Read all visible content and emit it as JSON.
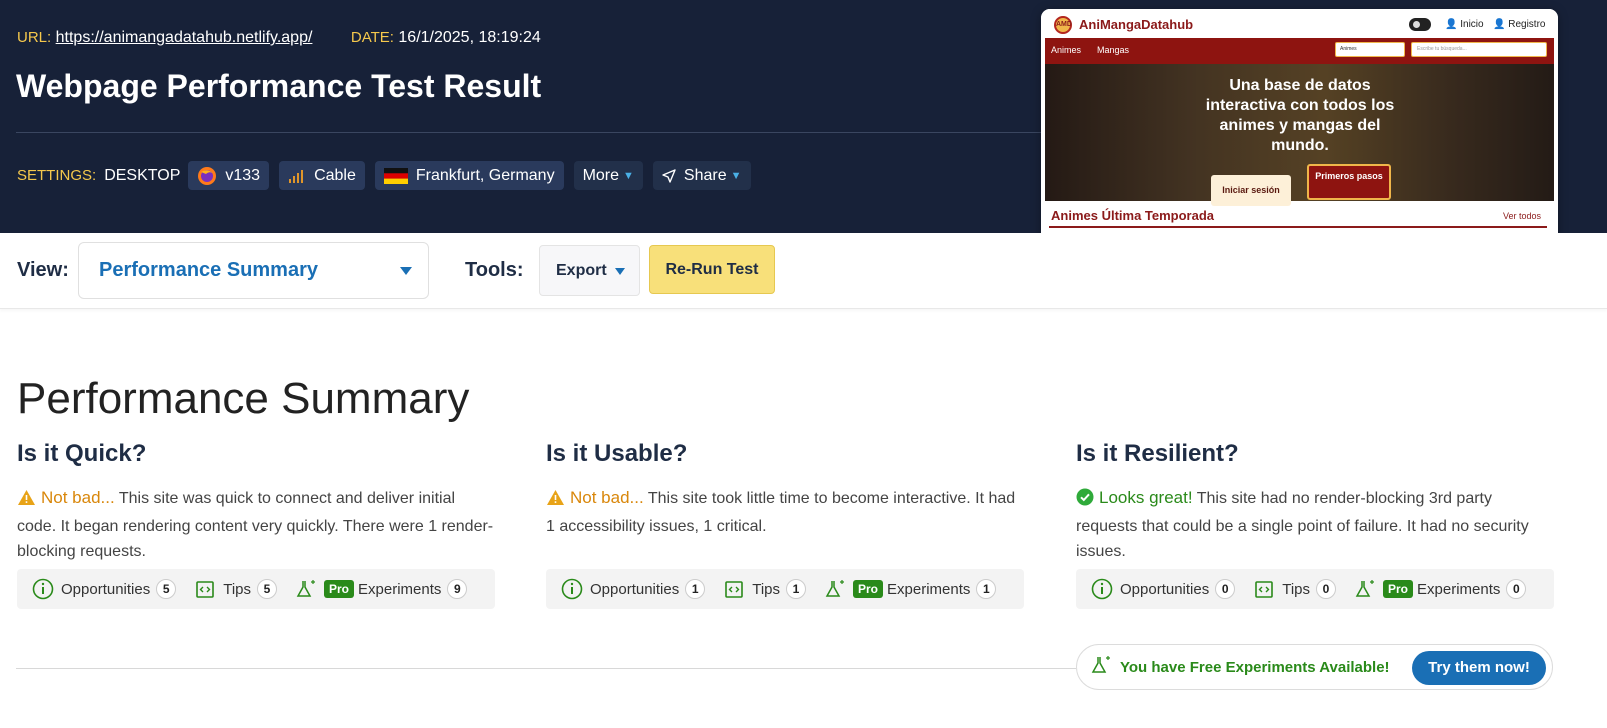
{
  "header": {
    "url_label": "URL:",
    "url": "https://animangadatahub.netlify.app/",
    "date_label": "DATE:",
    "date": "16/1/2025, 18:19:24",
    "title": "Webpage Performance Test Result",
    "settings_label": "SETTINGS:",
    "device": "DESKTOP",
    "browser_version": "v133",
    "connection": "Cable",
    "location": "Frankfurt, Germany",
    "more_label": "More",
    "share_label": "Share"
  },
  "thumbnail": {
    "brand": "AniMangaDatahub",
    "logo_text": "AMD",
    "links": [
      "Inicio",
      "Registro"
    ],
    "nav": [
      "Animes",
      "Mangas"
    ],
    "select_value": "Animes",
    "search_placeholder": "Escribe tu búsqueda...",
    "hero_text": "Una base de datos interactiva con todos los animes y mangas del mundo.",
    "login_button": "Iniciar sesión",
    "first_steps_button": "Primeros pasos",
    "section_title": "Animes Última Temporada",
    "see_all": "Ver todos"
  },
  "toolbar": {
    "view_label": "View:",
    "view_value": "Performance Summary",
    "tools_label": "Tools:",
    "export_label": "Export",
    "rerun_label": "Re-Run Test"
  },
  "summary": {
    "title": "Performance Summary",
    "columns": [
      {
        "heading": "Is it Quick?",
        "verdict": "Not bad...",
        "text": " This site was quick to connect and deliver initial code. It began rendering content very quickly. There were 1 render-blocking requests.",
        "opportunities": "5",
        "tips": "5",
        "experiments": "9"
      },
      {
        "heading": "Is it Usable?",
        "verdict": "Not bad...",
        "text": " This site took little time to become interactive. It had 1 accessibility issues, 1 critical.",
        "opportunities": "1",
        "tips": "1",
        "experiments": "1"
      },
      {
        "heading": "Is it Resilient?",
        "verdict": "Looks great!",
        "text": " This site had no render-blocking 3rd party requests that could be a single point of failure. It had no security issues.",
        "opportunities": "0",
        "tips": "0",
        "experiments": "0"
      }
    ],
    "labels": {
      "opportunities": "Opportunities",
      "tips": "Tips",
      "pro": "Pro",
      "experiments": "Experiments"
    }
  },
  "free_banner": {
    "text": "You have Free Experiments Available!",
    "button": "Try them now!"
  },
  "colors": {
    "header_bg": "#172138",
    "accent_yellow": "#f5c84c",
    "link_blue": "#1a6fb5",
    "warn_orange": "#d9870b",
    "good_green": "#2a8a1a"
  }
}
